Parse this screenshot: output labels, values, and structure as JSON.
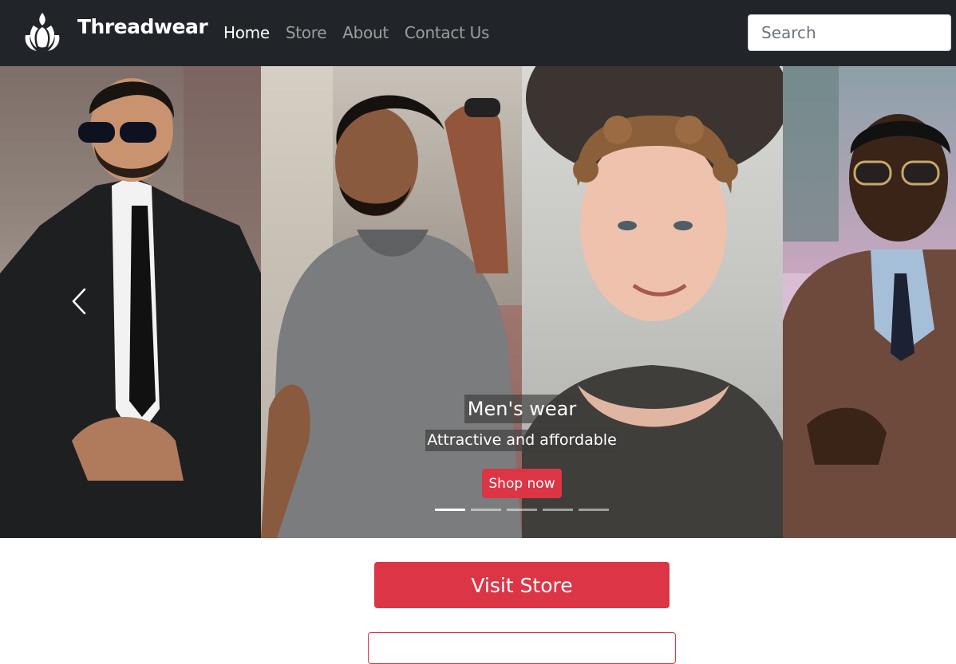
{
  "navbar": {
    "brand": "Threadwear",
    "logo_icon": "lotus-icon",
    "links": [
      {
        "label": "Home",
        "active": true
      },
      {
        "label": "Store",
        "active": false
      },
      {
        "label": "About",
        "active": false
      },
      {
        "label": "Contact Us",
        "active": false
      }
    ],
    "search_placeholder": "Search"
  },
  "carousel": {
    "caption_title": "Men's wear",
    "caption_subtitle": "Attractive and affordable",
    "cta_label": "Shop now",
    "indicator_count": 5,
    "active_indicator": 0,
    "prev_icon": "chevron-left-icon"
  },
  "main": {
    "visit_store_label": "Visit Store"
  },
  "colors": {
    "navbar_bg": "#212529",
    "accent": "#dc3545"
  }
}
